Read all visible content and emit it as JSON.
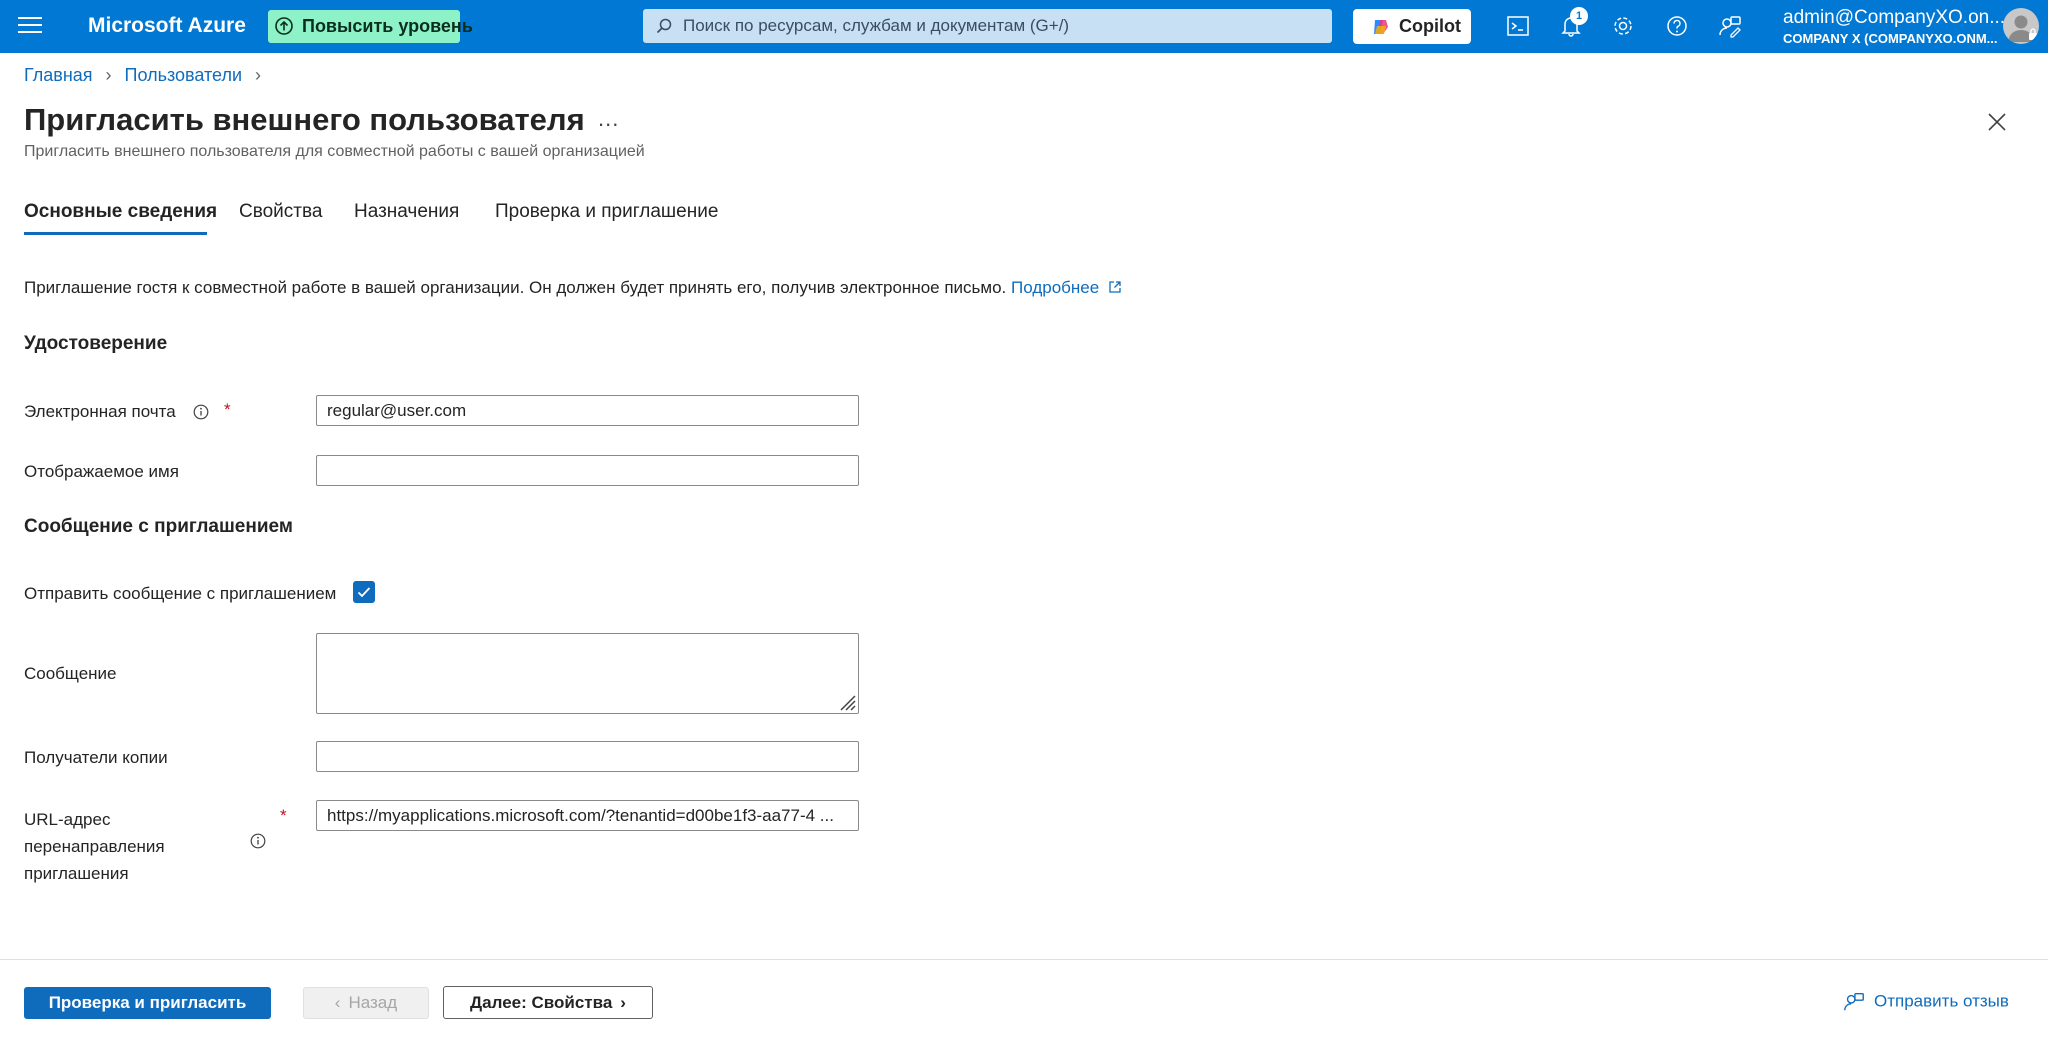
{
  "topbar": {
    "brand": "Microsoft Azure",
    "upgrade_label": "Повысить уровень",
    "search_placeholder": "Поиск по ресурсам, службам и документам (G+/)",
    "copilot_label": "Copilot",
    "notifications_count": "1",
    "account_name": "admin@CompanyXO.on...",
    "account_tenant": "COMPANY X (COMPANYXO.ONM..."
  },
  "breadcrumb": [
    "Главная",
    "Пользователи"
  ],
  "page": {
    "title": "Пригласить внешнего пользователя",
    "more": "...",
    "subtitle": "Пригласить внешнего пользователя для совместной работы с вашей организацией"
  },
  "tabs": [
    "Основные сведения",
    "Свойства",
    "Назначения",
    "Проверка и приглашение"
  ],
  "intro": {
    "text": "Приглашение гостя к совместной работе в вашей организации. Он должен будет принять его, получив электронное письмо.",
    "link": "Подробнее"
  },
  "identity": {
    "heading": "Удостоверение",
    "email_label": "Электронная почта",
    "email_value": "regular@user.com",
    "display_name_label": "Отображаемое имя",
    "display_name_value": ""
  },
  "invitation": {
    "heading": "Сообщение с приглашением",
    "send_label": "Отправить сообщение с приглашением",
    "send_checked": true,
    "message_label": "Сообщение",
    "cc_label": "Получатели копии",
    "redirect_label_lines": [
      "URL-адрес",
      "перенаправления",
      "приглашения"
    ],
    "redirect_value": "https://myapplications.microsoft.com/?tenantid=d00be1f3-aa77-4 ..."
  },
  "footer": {
    "review_button": "Проверка и пригласить",
    "back_button": "Назад",
    "next_button": "Далее: Свойства",
    "feedback": "Отправить отзыв"
  },
  "colors": {
    "azure_blue": "#0078d4",
    "link_blue": "#0f6cbd",
    "upgrade_green": "#8ef2c9",
    "required_red": "#c50f1f"
  }
}
